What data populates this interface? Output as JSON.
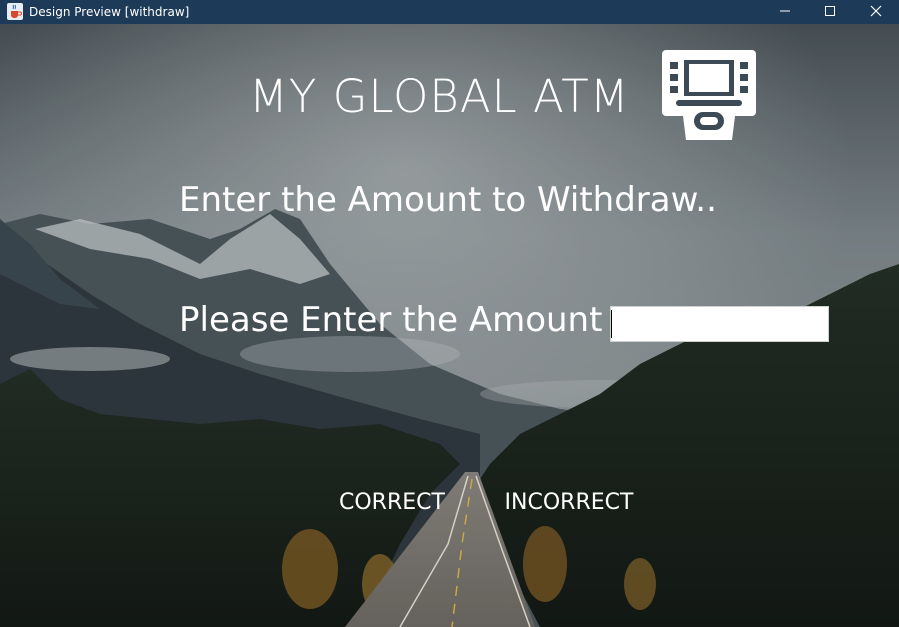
{
  "window": {
    "title": "Design Preview [withdraw]",
    "app_icon": "java-coffee-icon",
    "controls": {
      "minimize_icon": "minimize-icon",
      "maximize_icon": "maximize-icon",
      "close_icon": "close-icon"
    }
  },
  "main": {
    "title": "MY GLOBAL ATM",
    "logo_icon": "atm-machine-icon",
    "heading": "Enter the Amount to Withdraw..",
    "amount_label": "Please Enter the Amount",
    "amount_value": "",
    "buttons": {
      "correct": "CORRECT",
      "incorrect": "INCORRECT"
    }
  },
  "colors": {
    "titlebar": "#1d3a58",
    "text": "#ffffff",
    "input_bg": "#ffffff"
  }
}
